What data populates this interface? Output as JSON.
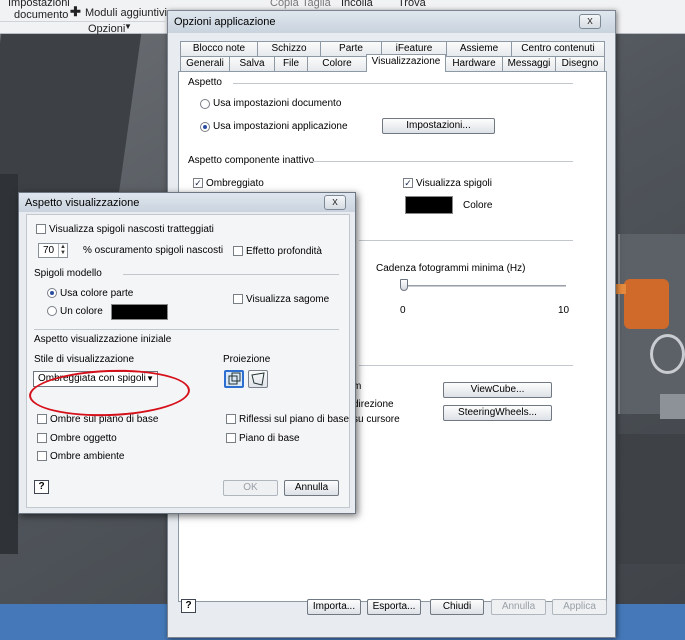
{
  "ribbon": {
    "items": [
      "Impostazioni",
      "documento",
      "Moduli aggiuntivi",
      "Copia",
      "Taglia",
      "Incolla",
      "Trova"
    ],
    "group_label": "Opzioni"
  },
  "main_dialog": {
    "title": "Opzioni applicazione",
    "close": "x",
    "tabs_row1": [
      "Blocco note",
      "Schizzo",
      "Parte",
      "iFeature",
      "Assieme",
      "Centro contenuti"
    ],
    "tabs_row2": [
      "Generali",
      "Salva",
      "File",
      "Colore",
      "Visualizzazione",
      "Hardware",
      "Messaggi",
      "Disegno"
    ],
    "selected_tab": "Visualizzazione",
    "aspetto": {
      "section": "Aspetto",
      "opt_document": "Usa impostazioni documento",
      "opt_application": "Usa impostazioni applicazione",
      "settings_button": "Impostazioni..."
    },
    "inactive": {
      "section": "Aspetto componente inattivo",
      "shaded": "Ombreggiato",
      "show_edges": "Visualizza spigoli",
      "color_label": "Colore"
    },
    "frame_rate": {
      "label": "Cadenza fotogrammi minima (Hz)",
      "min": "0",
      "max": "10",
      "value": 0
    },
    "partial_texts": [
      "m",
      "direzione",
      "su cursore"
    ],
    "viewcube_button": "ViewCube...",
    "steering_button": "SteeringWheels...",
    "footer": {
      "help": "?",
      "import": "Importa...",
      "export": "Esporta...",
      "close": "Chiudi",
      "cancel": "Annulla",
      "apply": "Applica"
    }
  },
  "front_dialog": {
    "title": "Aspetto visualizzazione",
    "close": "x",
    "hidden_edges": "Visualizza spigoli nascosti tratteggiati",
    "dimming_value": "70",
    "dimming_label": "% oscuramento spigoli nascosti",
    "depth_effect": "Effetto profondità",
    "model_edges": {
      "section": "Spigoli modello",
      "part_color": "Usa colore parte",
      "one_color": "Un colore",
      "show_silhouette": "Visualizza sagome"
    },
    "initial": {
      "section": "Aspetto visualizzazione iniziale",
      "style_label": "Stile di visualizzazione",
      "style_value": "Ombreggiata con spigoli",
      "projection_label": "Proiezione",
      "ground_shadows": "Ombre sul piano di base",
      "ground_reflections": "Riflessi sul piano di base",
      "object_shadows": "Ombre oggetto",
      "ground_plane": "Piano di base",
      "ambient_shadows": "Ombre ambiente"
    },
    "footer": {
      "help": "?",
      "ok": "OK",
      "cancel": "Annulla"
    }
  }
}
